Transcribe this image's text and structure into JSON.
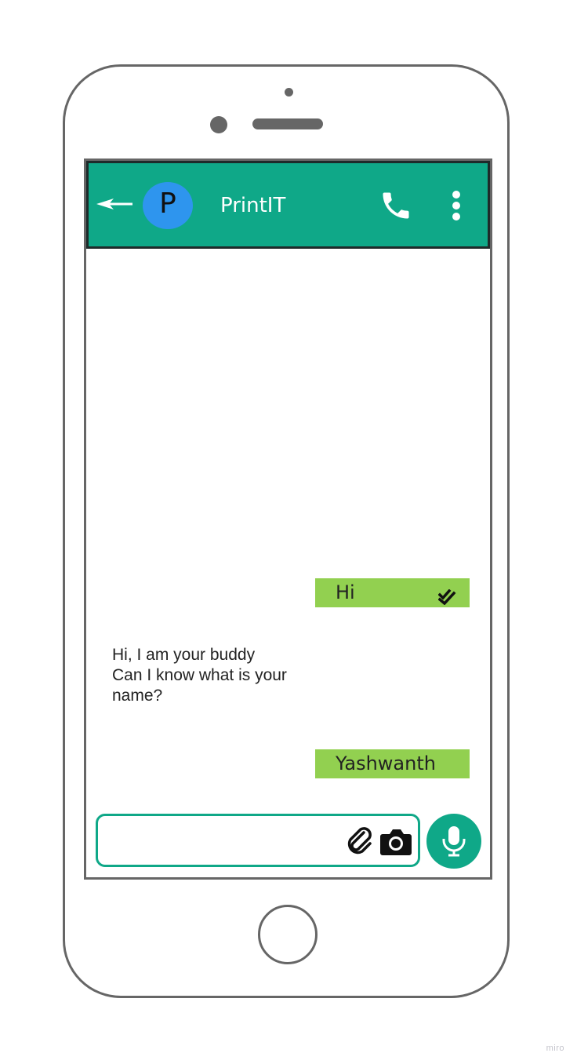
{
  "chat_header": {
    "avatar_letter": "P",
    "contact_name": "PrintIT",
    "back_icon": "back-arrow-icon",
    "call_icon": "phone-icon",
    "menu_icon": "more-vertical-icon"
  },
  "messages": [
    {
      "direction": "outgoing",
      "text": "Hi",
      "status": "read"
    },
    {
      "direction": "incoming",
      "lines": [
        "Hi, I am your buddy",
        "Can I know what is your",
        "name?"
      ]
    },
    {
      "direction": "outgoing",
      "text": "Yashwanth"
    }
  ],
  "composer": {
    "value": "",
    "placeholder": "",
    "attach_icon": "paperclip-icon",
    "camera_icon": "camera-icon",
    "mic_icon": "microphone-icon"
  },
  "watermark": "miro",
  "colors": {
    "header": "#0fa888",
    "avatar": "#2e95ee",
    "outgoing_bubble": "#92d050",
    "phone_frame": "#666666"
  }
}
